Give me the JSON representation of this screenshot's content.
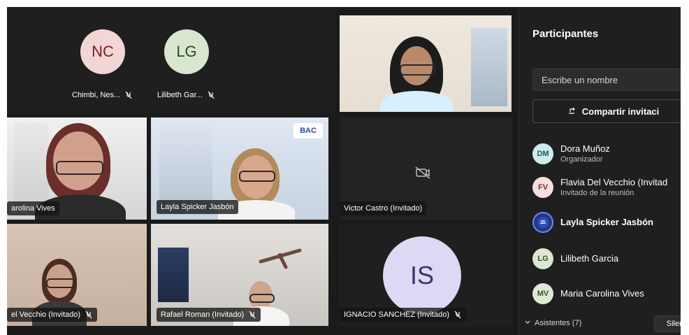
{
  "participants_tiles": {
    "nc": {
      "initials": "NC",
      "name": "Chimbi, Nes..."
    },
    "lg": {
      "initials": "LG",
      "name": "Lilibeth Gar..."
    },
    "carolina": {
      "name": "arolina Vives"
    },
    "layla": {
      "name": "Layla Spicker Jasbón",
      "logo": "BAC"
    },
    "victor": {
      "name": "Victor Castro (Invitado)"
    },
    "vecchio": {
      "name": "el Vecchio (Invitado)"
    },
    "rafael": {
      "name": "Rafael Roman (Invitado)"
    },
    "ignacio": {
      "initials": "IS",
      "name": "IGNACIO SANCHEZ (Invitado)"
    }
  },
  "panel": {
    "title": "Participantes",
    "search_placeholder": "Escribe un nombre",
    "share_label": "Compartir invitaci",
    "people": [
      {
        "initials": "DM",
        "name": "Dora Muñoz",
        "subtitle": "Organizador"
      },
      {
        "initials": "FV",
        "name": "Flavia Del Vecchio (Invitad",
        "subtitle": "Invitado de la reunión"
      },
      {
        "initials": "",
        "name": "Layla Spicker Jasbón",
        "subtitle": ""
      },
      {
        "initials": "LG",
        "name": "Lilibeth Garcia",
        "subtitle": ""
      },
      {
        "initials": "MV",
        "name": "Maria Carolina Vives",
        "subtitle": ""
      }
    ],
    "attendees_label": "Asistentes (7)",
    "mute_label": "Silen"
  },
  "icons": {
    "mic_off": "mic-off-icon",
    "camera_off": "camera-off-icon",
    "share": "share-icon",
    "chevron": "chevron-down-icon"
  }
}
